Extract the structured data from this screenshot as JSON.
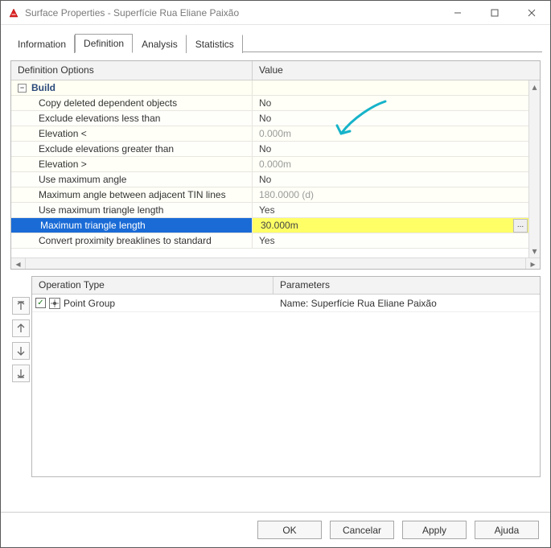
{
  "window": {
    "title": "Surface Properties - Superfície Rua Eliane Paixão"
  },
  "tabs": {
    "items": [
      {
        "label": "Information"
      },
      {
        "label": "Definition"
      },
      {
        "label": "Analysis"
      },
      {
        "label": "Statistics"
      }
    ],
    "active_index": 1
  },
  "grid": {
    "headers": {
      "options": "Definition Options",
      "value": "Value"
    },
    "group_label": "Build",
    "rows": [
      {
        "label": "Copy deleted dependent objects",
        "value": "No"
      },
      {
        "label": "Exclude elevations less than",
        "value": "No"
      },
      {
        "label": "Elevation <",
        "value": "0.000m",
        "dim": true
      },
      {
        "label": "Exclude elevations greater than",
        "value": "No"
      },
      {
        "label": "Elevation >",
        "value": "0.000m",
        "dim": true
      },
      {
        "label": "Use maximum angle",
        "value": "No"
      },
      {
        "label": "Maximum angle between adjacent TIN lines",
        "value": "180.0000 (d)",
        "dim": true
      },
      {
        "label": "Use maximum triangle length",
        "value": "Yes"
      },
      {
        "label": "Maximum triangle length",
        "value": "30.000m",
        "selected": true,
        "ellipsis": true
      },
      {
        "label": "Convert proximity breaklines to standard",
        "value": "Yes"
      }
    ]
  },
  "ops": {
    "headers": {
      "type": "Operation Type",
      "params": "Parameters"
    },
    "rows": [
      {
        "checked": true,
        "icon": "point-group-icon",
        "type": "Point Group",
        "params": "Name: Superfície Rua Eliane Paixão"
      }
    ]
  },
  "footer": {
    "ok": "OK",
    "cancel": "Cancelar",
    "apply": "Apply",
    "help": "Ajuda"
  },
  "ellipsis_label": "..."
}
